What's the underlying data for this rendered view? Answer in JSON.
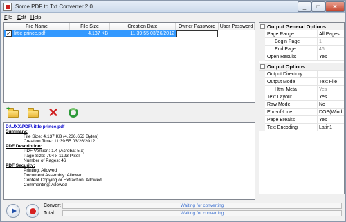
{
  "window": {
    "title": "Some PDF to Txt Converter 2.0",
    "minimize": "_",
    "maximize": "□",
    "close": "✕"
  },
  "menu": [
    "File",
    "Edit",
    "Help"
  ],
  "file_list": {
    "columns": [
      "File Name",
      "File Size",
      "Creation Date",
      "Owner Password",
      "User Password"
    ],
    "rows": [
      {
        "checked": true,
        "name": "little prince.pdf",
        "size": "4,137 KB",
        "date": "11:39:55 03/26/2012",
        "owner_password": "",
        "user_password": ""
      }
    ]
  },
  "properties": {
    "general": {
      "title": "Output General Options",
      "page_range": {
        "label": "Page Range",
        "value": "All Pages"
      },
      "begin_page": {
        "label": "Begin Page",
        "value": "1"
      },
      "end_page": {
        "label": "End Page",
        "value": "46"
      },
      "open_results": {
        "label": "Open Results",
        "value": "Yes"
      }
    },
    "output": {
      "title": "Output Options",
      "output_directory": {
        "label": "Output Directory",
        "value": ""
      },
      "output_mode": {
        "label": "Output Mode",
        "value": "Text File"
      },
      "html_meta": {
        "label": "Html Meta",
        "value": "Yes"
      },
      "text_layout": {
        "label": "Text Layout",
        "value": "Yes"
      },
      "raw_mode": {
        "label": "Raw Mode",
        "value": "No"
      },
      "end_of_line": {
        "label": "End-of-Line",
        "value": "DOS(Wind"
      },
      "page_breaks": {
        "label": "Page Breaks",
        "value": "Yes"
      },
      "text_encoding": {
        "label": "Text Encoding",
        "value": "Latin1"
      }
    }
  },
  "toolbar": {
    "add_file_icon": "add-file-icon",
    "open_folder_icon": "open-folder-icon",
    "delete_icon": "delete-icon",
    "clear_icon": "clear-list-icon",
    "delete_glyph": "✕",
    "add_glyph": "+"
  },
  "info": {
    "path": "D:\\UXX\\PDF\\little prince.pdf",
    "summary_head": "Summary:",
    "file_size": "File Size: 4,137 KB (4,236,653 Bytes)",
    "creation_time": "Creation Time: 11:39:55 03/26/2012",
    "pdf_description_head": "PDF Description:",
    "pdf_version": "PDF Version: 1.4 (Acrobat 5.x)",
    "page_size": "Page Size: 794 x 1123 Pixel",
    "number_of_pages": "Number of Pages: 46",
    "pdf_security_head": "PDF Security:",
    "printing": "Printing: Allowed",
    "document_assembly": "Document Assembly: Allowed",
    "content_copying": "Content Copying or Extraction: Allowed",
    "commenting": "Commenting: Allowed"
  },
  "progress": {
    "convert_label": "Convert",
    "convert_status": "Waiting for converting",
    "total_label": "Total",
    "total_status": "Waiting for converting"
  },
  "colors": {
    "selection": "#3399ff",
    "path_link": "#0000cc",
    "stop_button": "#d62020",
    "play_button": "#1f4ea8"
  }
}
